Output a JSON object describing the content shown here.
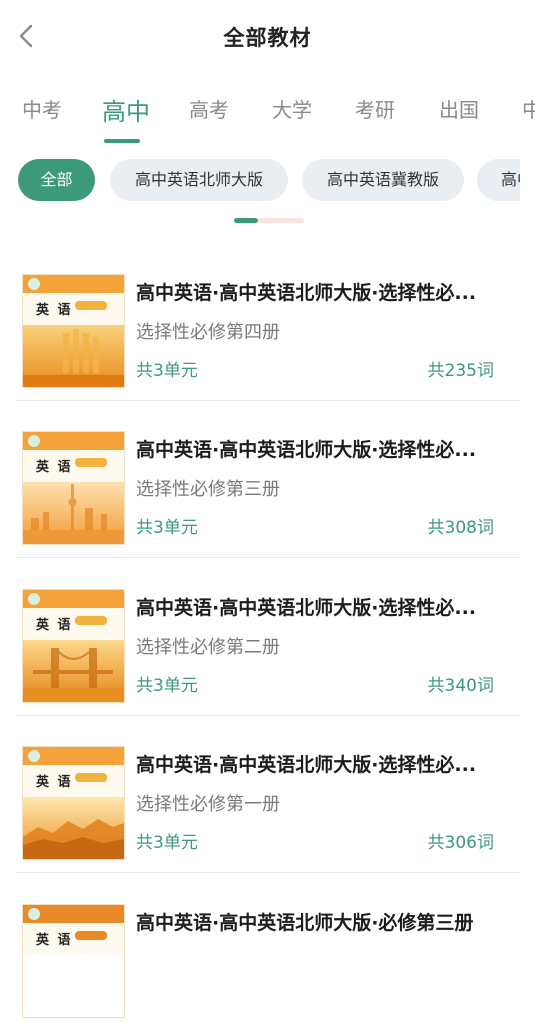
{
  "header": {
    "title": "全部教材"
  },
  "colors": {
    "accent": "#3c9a78",
    "chip_bg": "#e9eef3"
  },
  "tabs": [
    "中考",
    "高中",
    "高考",
    "大学",
    "考研",
    "出国",
    "中"
  ],
  "active_tab": "高中",
  "chips": [
    "全部",
    "高中英语北师大版",
    "高中英语冀教版",
    "高中"
  ],
  "books": [
    {
      "title": "高中英语·高中英语北师大版·选择性必...",
      "subtitle": "选择性必修第四册",
      "units": "共3单元",
      "words": "共235词",
      "cover_word": "英 语"
    },
    {
      "title": "高中英语·高中英语北师大版·选择性必...",
      "subtitle": "选择性必修第三册",
      "units": "共3单元",
      "words": "共308词",
      "cover_word": "英 语"
    },
    {
      "title": "高中英语·高中英语北师大版·选择性必...",
      "subtitle": "选择性必修第二册",
      "units": "共3单元",
      "words": "共340词",
      "cover_word": "英 语"
    },
    {
      "title": "高中英语·高中英语北师大版·选择性必...",
      "subtitle": "选择性必修第一册",
      "units": "共3单元",
      "words": "共306词",
      "cover_word": "英 语"
    },
    {
      "title": "高中英语·高中英语北师大版·必修第三册",
      "subtitle": "",
      "units": "",
      "words": "",
      "cover_word": "英 语"
    }
  ]
}
